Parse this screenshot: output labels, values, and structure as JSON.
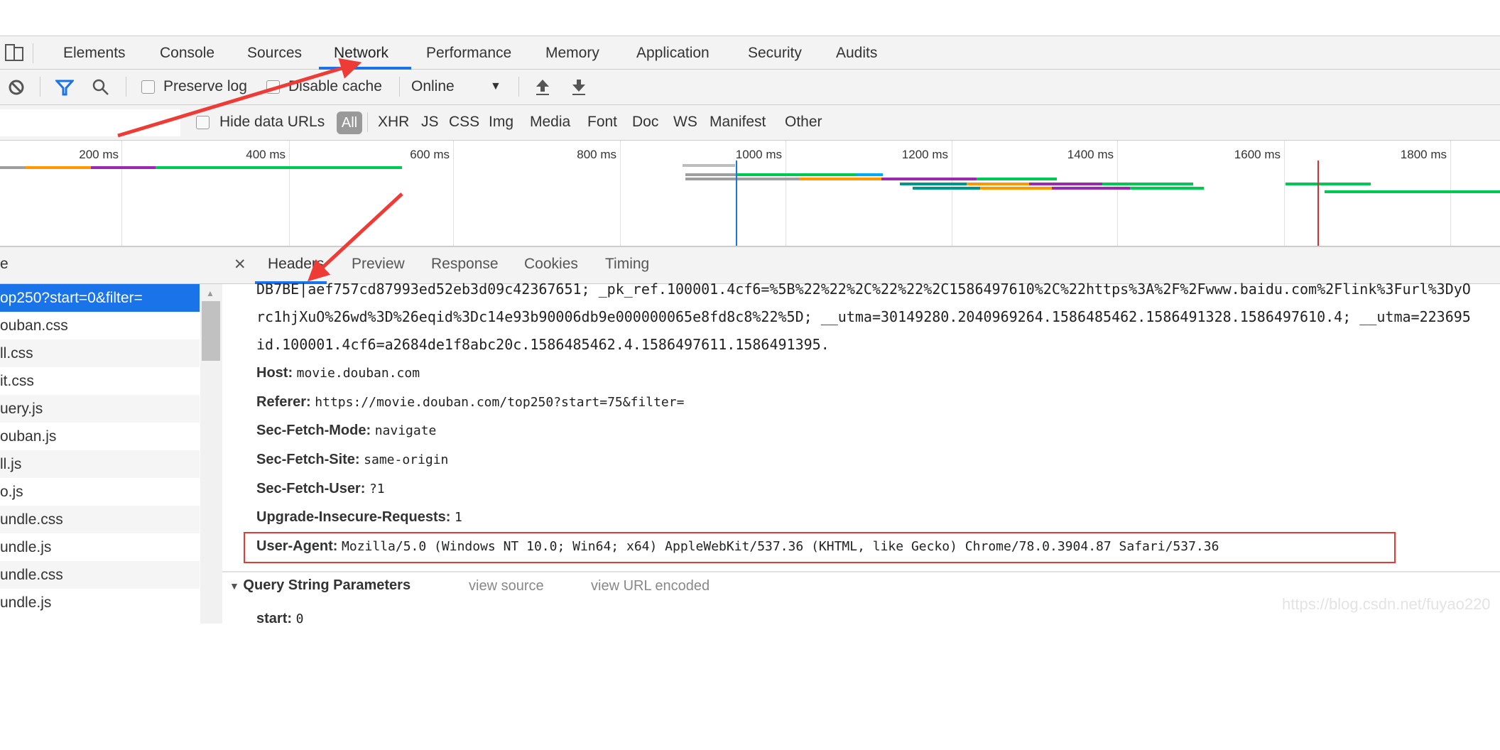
{
  "tabs": [
    "Elements",
    "Console",
    "Sources",
    "Network",
    "Performance",
    "Memory",
    "Application",
    "Security",
    "Audits"
  ],
  "active_tab": "Network",
  "toolbar": {
    "preserve_log": "Preserve log",
    "disable_cache": "Disable cache",
    "throttle": "Online"
  },
  "filter": {
    "input_value": "",
    "hide_data_urls": "Hide data URLs",
    "types": [
      "All",
      "XHR",
      "JS",
      "CSS",
      "Img",
      "Media",
      "Font",
      "Doc",
      "WS",
      "Manifest",
      "Other"
    ],
    "active_type": "All"
  },
  "timeline": {
    "ticks": [
      "200 ms",
      "400 ms",
      "600 ms",
      "800 ms",
      "1000 ms",
      "1200 ms",
      "1400 ms",
      "1600 ms",
      "1800 ms"
    ],
    "dom_content_loaded_ms": 938,
    "load_ms": 1636,
    "bars": [
      {
        "row": 0,
        "start": 54,
        "end": 85,
        "color": "#9e9e9e"
      },
      {
        "row": 0,
        "start": 85,
        "end": 163,
        "color": "#ff9800"
      },
      {
        "row": 0,
        "start": 163,
        "end": 241,
        "color": "#9c27b0"
      },
      {
        "row": 0,
        "start": 241,
        "end": 537,
        "color": "#00c853"
      },
      {
        "row": -1,
        "start": 874,
        "end": 937,
        "color": "#bdbdbd"
      },
      {
        "row": 1,
        "start": 877,
        "end": 939,
        "color": "#9e9e9e"
      },
      {
        "row": 1,
        "start": 939,
        "end": 1083,
        "color": "#00c853"
      },
      {
        "row": 1,
        "start": 1083,
        "end": 1114,
        "color": "#03a9f4"
      },
      {
        "row": 2,
        "start": 877,
        "end": 1014,
        "color": "#9e9e9e"
      },
      {
        "row": 2,
        "start": 1014,
        "end": 1113,
        "color": "#ff9800"
      },
      {
        "row": 2,
        "start": 1113,
        "end": 1227,
        "color": "#9c27b0"
      },
      {
        "row": 2,
        "start": 1227,
        "end": 1323,
        "color": "#00c853"
      },
      {
        "row": 3,
        "start": 1135,
        "end": 1215,
        "color": "#009688"
      },
      {
        "row": 3,
        "start": 1215,
        "end": 1290,
        "color": "#ff9800"
      },
      {
        "row": 3,
        "start": 1290,
        "end": 1378,
        "color": "#9c27b0"
      },
      {
        "row": 3,
        "start": 1378,
        "end": 1487,
        "color": "#00c853"
      },
      {
        "row": 3,
        "start": 1598,
        "end": 1700,
        "color": "#00c853"
      },
      {
        "row": 4,
        "start": 1150,
        "end": 1231,
        "color": "#009688"
      },
      {
        "row": 4,
        "start": 1231,
        "end": 1317,
        "color": "#ff9800"
      },
      {
        "row": 4,
        "start": 1317,
        "end": 1411,
        "color": "#9c27b0"
      },
      {
        "row": 4,
        "start": 1411,
        "end": 1500,
        "color": "#00c853"
      },
      {
        "row": 5,
        "start": 1645,
        "end": 1860,
        "color": "#00c853"
      }
    ]
  },
  "left": {
    "header": "e",
    "rows": [
      "op250?start=0&filter=",
      "ouban.css",
      "ll.css",
      "it.css",
      "uery.js",
      "ouban.js",
      "ll.js",
      "o.js",
      "undle.css",
      "undle.js",
      "undle.css",
      "undle.js"
    ]
  },
  "detail": {
    "tabs": [
      "Headers",
      "Preview",
      "Response",
      "Cookies",
      "Timing"
    ],
    "active_tab": "Headers",
    "cookie_lines": [
      "DB7BE|aef757cd87993ed52eb3d09c42367651; _pk_ref.100001.4cf6=%5B%22%22%2C%22%22%2C1586497610%2C%22https%3A%2F%2Fwww.baidu.com%2Flink%3Furl%3DyO",
      "rc1hjXuO%26wd%3D%26eqid%3Dc14e93b90006db9e000000065e8fd8c8%22%5D; __utma=30149280.2040969264.1586485462.1586491328.1586497610.4; __utma=223695",
      "id.100001.4cf6=a2684de1f8abc20c.1586485462.4.1586497611.1586491395."
    ],
    "headers": [
      {
        "key": "Host:",
        "value": "movie.douban.com"
      },
      {
        "key": "Referer:",
        "value": "https://movie.douban.com/top250?start=75&filter="
      },
      {
        "key": "Sec-Fetch-Mode:",
        "value": "navigate"
      },
      {
        "key": "Sec-Fetch-Site:",
        "value": "same-origin"
      },
      {
        "key": "Sec-Fetch-User:",
        "value": "?1"
      },
      {
        "key": "Upgrade-Insecure-Requests:",
        "value": "1"
      },
      {
        "key": "User-Agent:",
        "value": "Mozilla/5.0 (Windows NT 10.0; Win64; x64) AppleWebKit/537.36 (KHTML, like Gecko) Chrome/78.0.3904.87 Safari/537.36"
      }
    ],
    "query_section": {
      "title": "Query String Parameters",
      "view_source": "view source",
      "view_url_encoded": "view URL encoded",
      "params": [
        {
          "key": "start:",
          "value": "0"
        }
      ]
    }
  },
  "watermark": "https://blog.csdn.net/fuyao220",
  "colors": {
    "accent": "#1a73e8",
    "annotation": "#e53935"
  }
}
